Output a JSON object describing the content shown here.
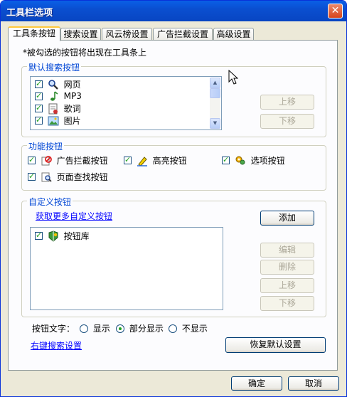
{
  "window": {
    "title": "工具栏选项",
    "close_glyph": "✕"
  },
  "tabs": [
    {
      "label": "工具条按钮",
      "active": true
    },
    {
      "label": "搜索设置",
      "active": false
    },
    {
      "label": "风云榜设置",
      "active": false
    },
    {
      "label": "广告拦截设置",
      "active": false
    },
    {
      "label": "高级设置",
      "active": false
    }
  ],
  "notice": "*被勾选的按钮将出现在工具条上",
  "default_search": {
    "title": "默认搜索按钮",
    "items": [
      {
        "label": "网页",
        "checked": true,
        "icon": "magnifier-icon"
      },
      {
        "label": "MP3",
        "checked": true,
        "icon": "music-note-icon"
      },
      {
        "label": "歌词",
        "checked": true,
        "icon": "lyrics-icon"
      },
      {
        "label": "图片",
        "checked": true,
        "icon": "picture-icon"
      }
    ],
    "move_up": "上移",
    "move_down": "下移"
  },
  "feature_buttons": {
    "title": "功能按钮",
    "items": [
      {
        "label": "广告拦截按钮",
        "checked": true,
        "icon": "ad-block-icon"
      },
      {
        "label": "高亮按钮",
        "checked": true,
        "icon": "highlighter-icon"
      },
      {
        "label": "选项按钮",
        "checked": true,
        "icon": "options-icon"
      },
      {
        "label": "页面查找按钮",
        "checked": true,
        "icon": "page-find-icon"
      }
    ]
  },
  "custom_buttons": {
    "title": "自定义按钮",
    "get_more_link": "获取更多自定义按钮",
    "items": [
      {
        "label": "按钮库",
        "checked": true,
        "icon": "button-library-icon"
      }
    ],
    "add": "添加",
    "edit": "编辑",
    "delete": "删除",
    "move_up": "上移",
    "move_down": "下移"
  },
  "button_text": {
    "label": "按钮文字：",
    "options": [
      {
        "label": "显示",
        "selected": false
      },
      {
        "label": "部分显示",
        "selected": true
      },
      {
        "label": "不显示",
        "selected": false
      }
    ]
  },
  "right_click_link": "右键搜索设置",
  "restore_defaults": "恢复默认设置",
  "ok": "确定",
  "cancel": "取消",
  "colors": {
    "titlebar": "#0a4fd0",
    "group_title": "#0046d5",
    "link": "#0000ff",
    "check": "#21a121"
  }
}
